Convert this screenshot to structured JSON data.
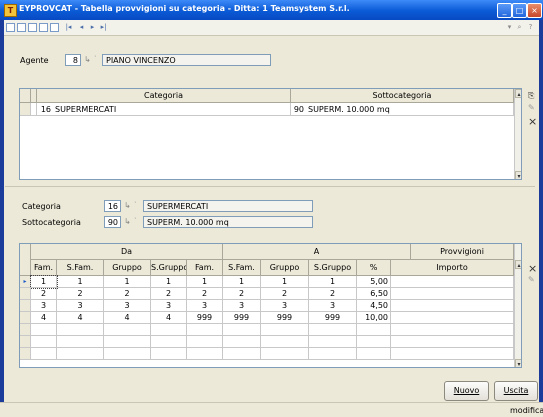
{
  "window": {
    "title": "EYPROVCAT - Tabella provvigioni su categoria - Ditta:   1 Teamsystem S.r.l.",
    "controls": {
      "minimize": "_",
      "maximize": "□",
      "close": "×"
    }
  },
  "toolbar": {
    "left_icons": [
      "new-doc-icon",
      "open-doc-icon",
      "save-doc-icon",
      "print-icon",
      "preview-icon",
      "first-record-icon",
      "prev-record-icon",
      "next-record-icon",
      "last-record-icon"
    ],
    "nav_glyphs": {
      "first": "|◂",
      "prev": "◂",
      "next": "▸",
      "last": "▸|"
    }
  },
  "agente": {
    "label": "Agente",
    "code": "8",
    "name": "PIANO VINCENZO"
  },
  "lookup_glyph": "↳ ˙",
  "categoria_grid": {
    "headers": {
      "categoria": "Categoria",
      "sottocategoria": "Sottocategoria"
    },
    "rows": [
      {
        "cat_code": "16",
        "cat_name": "SUPERMERCATI",
        "sub_code": "90",
        "sub_name": "SUPERM. 10.000 mq"
      }
    ]
  },
  "detail": {
    "categoria_label": "Categoria",
    "categoria_code": "16",
    "categoria_name": "SUPERMERCATI",
    "sottocategoria_label": "Sottocategoria",
    "sottocategoria_code": "90",
    "sottocategoria_name": "SUPERM. 10.000 mq"
  },
  "provvigioni_grid": {
    "group_headers": {
      "da": "Da",
      "a": "A",
      "provvigioni": "Provvigioni"
    },
    "columns": [
      "Fam.",
      "S.Fam.",
      "Gruppo",
      "S.Gruppo",
      "Fam.",
      "S.Fam.",
      "Gruppo",
      "S.Gruppo",
      "%",
      "Importo"
    ],
    "rows": [
      [
        "1",
        "1",
        "1",
        "1",
        "1",
        "1",
        "1",
        "1",
        "5,00",
        ""
      ],
      [
        "2",
        "2",
        "2",
        "2",
        "2",
        "2",
        "2",
        "2",
        "6,50",
        ""
      ],
      [
        "3",
        "3",
        "3",
        "3",
        "3",
        "3",
        "3",
        "3",
        "4,50",
        ""
      ],
      [
        "4",
        "4",
        "4",
        "4",
        "999",
        "999",
        "999",
        "999",
        "10,00",
        ""
      ]
    ]
  },
  "buttons": {
    "nuovo": "Nuovo",
    "uscita": "Uscita"
  },
  "status": {
    "mode": "modifica"
  },
  "colors": {
    "titlebar": "#0a5ad6",
    "window_bg": "#ece9d8",
    "field_border": "#7f9db9"
  }
}
